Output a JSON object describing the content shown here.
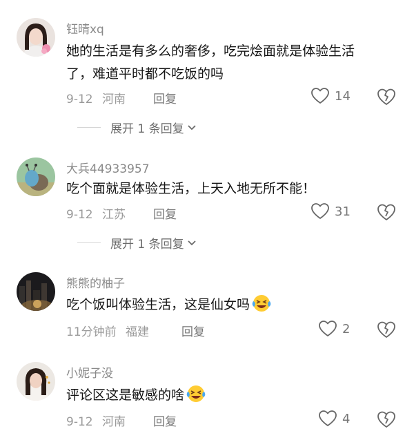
{
  "comments": [
    {
      "username": "钰晴xq",
      "text_lines": [
        "她的生活是有多么的奢侈，吃完烩面就是体验生活",
        "了，难道平时都不吃饭的吗"
      ],
      "time": "9-12",
      "location": "河南",
      "reply_label": "回复",
      "likes": "14",
      "expand_label": "展开 1 条回复",
      "avatar_icon": "woman-portrait-avatar"
    },
    {
      "username": "大兵44933957",
      "text_lines": [
        "吃个面就是体验生活，上天入地无所不能！"
      ],
      "time": "9-12",
      "location": "江苏",
      "reply_label": "回复",
      "likes": "31",
      "expand_label": "展开 1 条回复",
      "avatar_icon": "cartoon-snail-avatar"
    },
    {
      "username": "熊熊的柚子",
      "text": "吃个饭叫体验生活，这是仙女吗",
      "emoji": "laughing-crying-emoji",
      "time": "11分钟前",
      "location": "福建",
      "reply_label": "回复",
      "likes": "2",
      "avatar_icon": "city-night-avatar"
    },
    {
      "username": "小妮子没",
      "text": "评论区这是敏感的啥",
      "emoji": "laughing-crying-emoji",
      "time": "9-12",
      "location": "河南",
      "reply_label": "回复",
      "likes": "4",
      "avatar_icon": "girl-portrait-avatar"
    }
  ],
  "colors": {
    "text": "#161616",
    "secondary": "#9a9a9a",
    "icon": "#777777"
  }
}
